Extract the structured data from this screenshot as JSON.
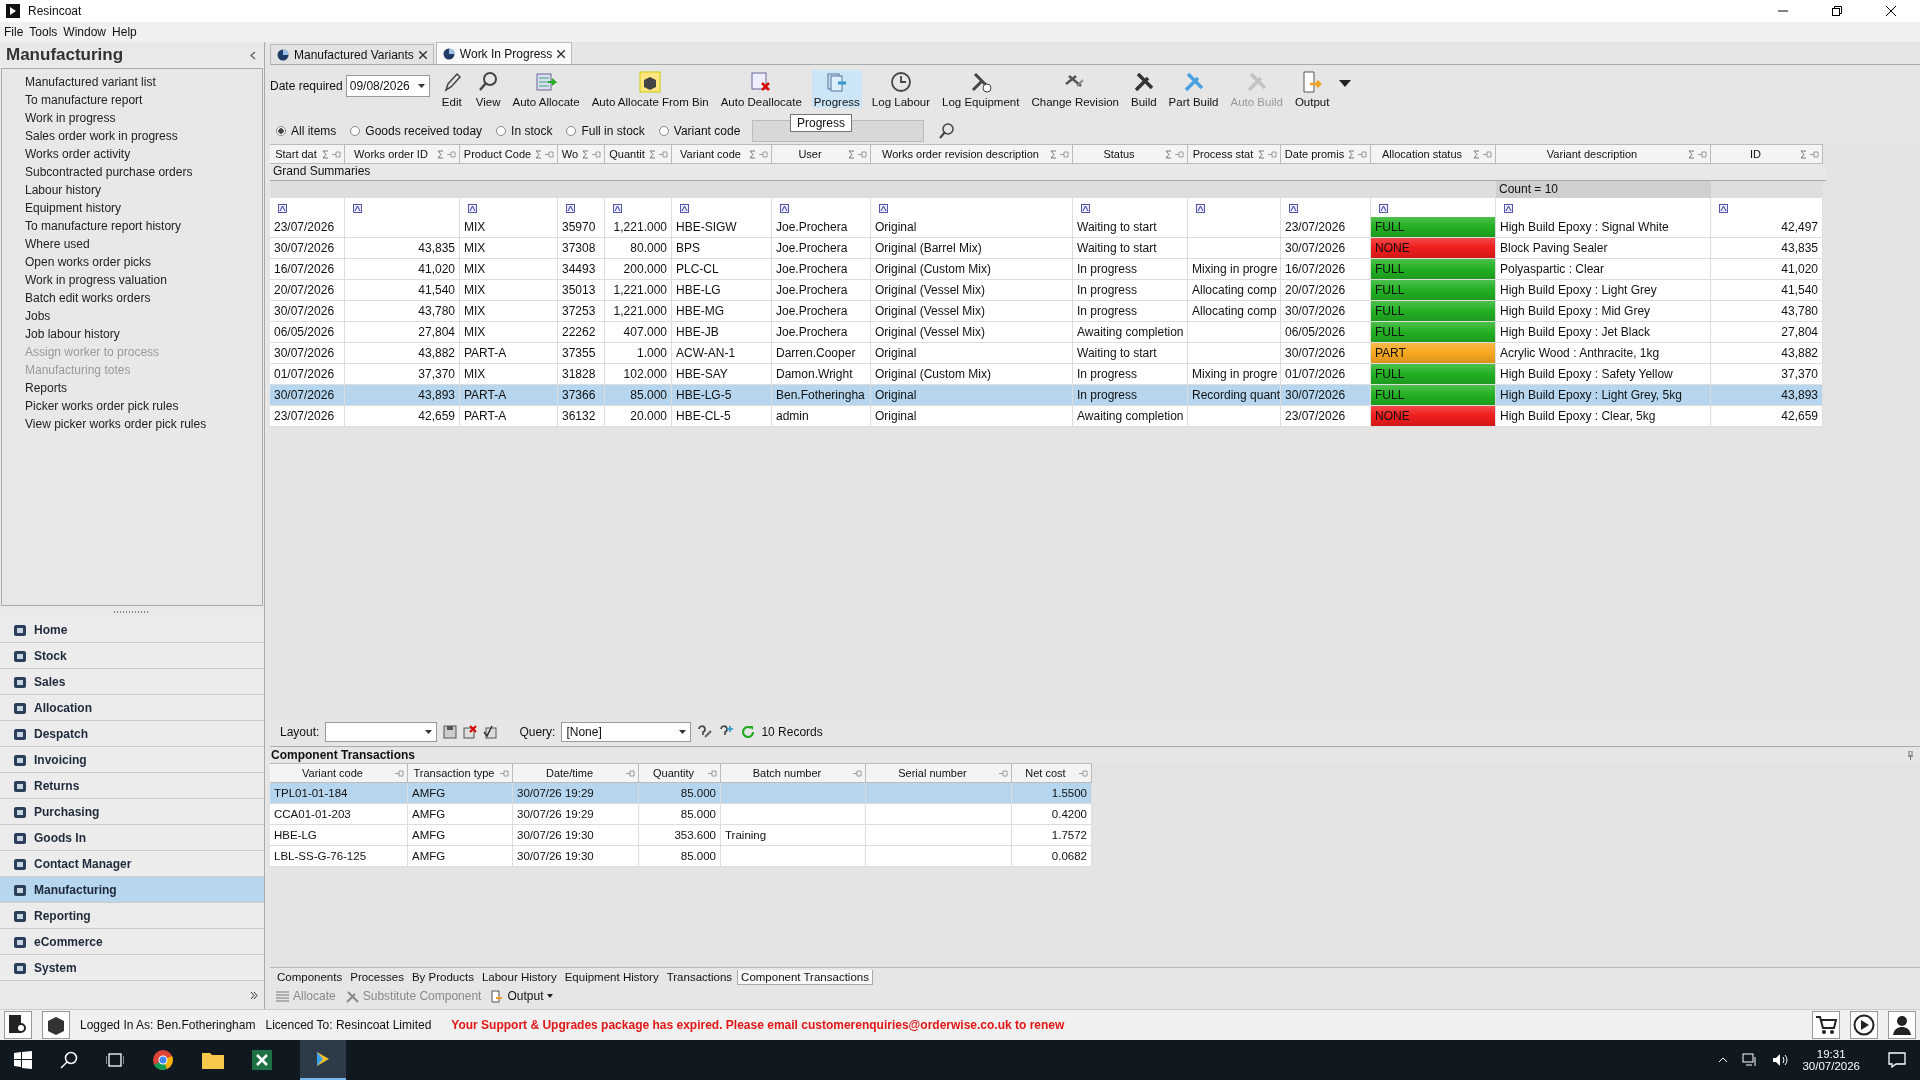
{
  "window": {
    "title": "Resincoat"
  },
  "menu": [
    "File",
    "Tools",
    "Window",
    "Help"
  ],
  "sidebar": {
    "title": "Manufacturing",
    "items": [
      {
        "label": "Manufactured variant list",
        "disabled": false
      },
      {
        "label": "To manufacture report",
        "disabled": false
      },
      {
        "label": "Work in progress",
        "disabled": false
      },
      {
        "label": "Sales order work in progress",
        "disabled": false
      },
      {
        "label": "Works order activity",
        "disabled": false
      },
      {
        "label": "Subcontracted purchase orders",
        "disabled": false
      },
      {
        "label": "Labour history",
        "disabled": false
      },
      {
        "label": "Equipment history",
        "disabled": false
      },
      {
        "label": "To manufacture report history",
        "disabled": false
      },
      {
        "label": "Where used",
        "disabled": false
      },
      {
        "label": "Open works order picks",
        "disabled": false
      },
      {
        "label": "Work in progress valuation",
        "disabled": false
      },
      {
        "label": "Batch edit works orders",
        "disabled": false
      },
      {
        "label": "Jobs",
        "disabled": false
      },
      {
        "label": "Job labour history",
        "disabled": false
      },
      {
        "label": "Assign worker to process",
        "disabled": true
      },
      {
        "label": "Manufacturing totes",
        "disabled": true
      },
      {
        "label": "Reports",
        "disabled": false
      },
      {
        "label": "Picker works order pick rules",
        "disabled": false
      },
      {
        "label": "View picker works order pick rules",
        "disabled": false
      }
    ],
    "modules": [
      {
        "label": "Home",
        "selected": false
      },
      {
        "label": "Stock",
        "selected": false
      },
      {
        "label": "Sales",
        "selected": false
      },
      {
        "label": "Allocation",
        "selected": false
      },
      {
        "label": "Despatch",
        "selected": false
      },
      {
        "label": "Invoicing",
        "selected": false
      },
      {
        "label": "Returns",
        "selected": false
      },
      {
        "label": "Purchasing",
        "selected": false
      },
      {
        "label": "Goods In",
        "selected": false
      },
      {
        "label": "Contact Manager",
        "selected": false
      },
      {
        "label": "Manufacturing",
        "selected": true
      },
      {
        "label": "Reporting",
        "selected": false
      },
      {
        "label": "eCommerce",
        "selected": false
      },
      {
        "label": "System",
        "selected": false
      }
    ]
  },
  "tabs": [
    {
      "label": "Manufactured Variants",
      "selected": false
    },
    {
      "label": "Work In Progress",
      "selected": true
    }
  ],
  "toolbar": {
    "date_label": "Date required",
    "date_value": "09/08/2026",
    "buttons": [
      {
        "label": "Edit",
        "disabled": false,
        "highlighted": false
      },
      {
        "label": "View",
        "disabled": false,
        "highlighted": false
      },
      {
        "label": "Auto Allocate",
        "disabled": false,
        "highlighted": false
      },
      {
        "label": "Auto Allocate From Bin",
        "disabled": false,
        "highlighted": false
      },
      {
        "label": "Auto Deallocate",
        "disabled": false,
        "highlighted": false
      },
      {
        "label": "Progress",
        "disabled": false,
        "highlighted": true
      },
      {
        "label": "Log Labour",
        "disabled": false,
        "highlighted": false
      },
      {
        "label": "Log Equipment",
        "disabled": false,
        "highlighted": false
      },
      {
        "label": "Change Revision",
        "disabled": false,
        "highlighted": false
      },
      {
        "label": "Build",
        "disabled": false,
        "highlighted": false
      },
      {
        "label": "Part Build",
        "disabled": false,
        "highlighted": false
      },
      {
        "label": "Auto Build",
        "disabled": true,
        "highlighted": false
      },
      {
        "label": "Output",
        "disabled": false,
        "highlighted": false
      }
    ],
    "tooltip": "Progress"
  },
  "filters": [
    {
      "label": "All items",
      "selected": true
    },
    {
      "label": "Goods received today",
      "selected": false
    },
    {
      "label": "In stock",
      "selected": false
    },
    {
      "label": "Full in stock",
      "selected": false
    },
    {
      "label": "Variant code",
      "selected": false
    }
  ],
  "table": {
    "columns": [
      "Start dat",
      "Works order ID",
      "Product Code",
      "Wo",
      "Quantit",
      "Variant code",
      "User",
      "Works order revision description",
      "Status",
      "Process stat",
      "Date promis",
      "Allocation status",
      "Variant description",
      "ID"
    ],
    "grand_summaries": "Grand Summaries",
    "count": "Count = 10",
    "rows": [
      {
        "selected": false,
        "cells": [
          "23/07/2026",
          "",
          "MIX",
          "35970",
          "1,221.000",
          "HBE-SIGW",
          "Joe.Prochera",
          "Original",
          "Waiting to start",
          "",
          "23/07/2026",
          "FULL",
          "High Build Epoxy : Signal White",
          "42,497"
        ],
        "color": "#22b022"
      },
      {
        "selected": false,
        "cells": [
          "30/07/2026",
          "43,835",
          "MIX",
          "37308",
          "80.000",
          "BPS",
          "Joe.Prochera",
          "Original (Barrel Mix)",
          "Waiting to start",
          "",
          "30/07/2026",
          "NONE",
          "Block Paving Sealer",
          "43,835"
        ],
        "color": "#f01c1c"
      },
      {
        "selected": false,
        "cells": [
          "16/07/2026",
          "41,020",
          "MIX",
          "34493",
          "200.000",
          "PLC-CL",
          "Joe.Prochera",
          "Original (Custom Mix)",
          "In progress",
          "Mixing in progre",
          "16/07/2026",
          "FULL",
          "Polyaspartic : Clear",
          "41,020"
        ],
        "color": "#22b022"
      },
      {
        "selected": false,
        "cells": [
          "20/07/2026",
          "41,540",
          "MIX",
          "35013",
          "1,221.000",
          "HBE-LG",
          "Joe.Prochera",
          "Original (Vessel Mix)",
          "In progress",
          "Allocating comp",
          "20/07/2026",
          "FULL",
          "High Build Epoxy : Light Grey",
          "41,540"
        ],
        "color": "#22b022"
      },
      {
        "selected": false,
        "cells": [
          "30/07/2026",
          "43,780",
          "MIX",
          "37253",
          "1,221.000",
          "HBE-MG",
          "Joe.Prochera",
          "Original (Vessel Mix)",
          "In progress",
          "Allocating comp",
          "30/07/2026",
          "FULL",
          "High Build Epoxy : Mid Grey",
          "43,780"
        ],
        "color": "#22b022"
      },
      {
        "selected": false,
        "cells": [
          "06/05/2026",
          "27,804",
          "MIX",
          "22262",
          "407.000",
          "HBE-JB",
          "Joe.Prochera",
          "Original (Vessel Mix)",
          "Awaiting completion",
          "",
          "06/05/2026",
          "FULL",
          "High Build Epoxy : Jet Black",
          "27,804"
        ],
        "color": "#22b022"
      },
      {
        "selected": false,
        "cells": [
          "30/07/2026",
          "43,882",
          "PART-A",
          "37355",
          "1.000",
          "ACW-AN-1",
          "Darren.Cooper",
          "Original",
          "Waiting to start",
          "",
          "30/07/2026",
          "PART",
          "Acrylic Wood : Anthracite, 1kg",
          "43,882"
        ],
        "color": "#f8a820"
      },
      {
        "selected": false,
        "cells": [
          "01/07/2026",
          "37,370",
          "MIX",
          "31828",
          "102.000",
          "HBE-SAY",
          "Damon.Wright",
          "Original (Custom Mix)",
          "In progress",
          "Mixing in progre",
          "01/07/2026",
          "FULL",
          "High Build Epoxy : Safety Yellow",
          "37,370"
        ],
        "color": "#22b022"
      },
      {
        "selected": true,
        "cells": [
          "30/07/2026",
          "43,893",
          "PART-A",
          "37366",
          "85.000",
          "HBE-LG-5",
          "Ben.Fotheringha",
          "Original",
          "In progress",
          "Recording quant",
          "30/07/2026",
          "FULL",
          "High Build Epoxy : Light Grey, 5kg",
          "43,893"
        ],
        "color": "#22b022"
      },
      {
        "selected": false,
        "cells": [
          "23/07/2026",
          "42,659",
          "PART-A",
          "36132",
          "20.000",
          "HBE-CL-5",
          "admin",
          "Original",
          "Awaiting completion",
          "",
          "23/07/2026",
          "NONE",
          "High Build Epoxy : Clear, 5kg",
          "42,659"
        ],
        "color": "#f01c1c"
      }
    ]
  },
  "layout_bar": {
    "layout_label": "Layout:",
    "query_label": "Query:",
    "query_value": "[None]",
    "records": "10 Records"
  },
  "component_transactions": {
    "title": "Component Transactions",
    "columns": [
      "Variant code",
      "Transaction type",
      "Date/time",
      "Quantity",
      "Batch number",
      "Serial number",
      "Net cost"
    ],
    "rows": [
      {
        "selected": true,
        "cells": [
          "TPL01-01-184",
          "AMFG",
          "30/07/26 19:29",
          "85.000",
          "",
          "",
          "1.5500"
        ]
      },
      {
        "selected": false,
        "cells": [
          "CCA01-01-203",
          "AMFG",
          "30/07/26 19:29",
          "85.000",
          "",
          "",
          "0.4200"
        ]
      },
      {
        "selected": false,
        "cells": [
          "HBE-LG",
          "AMFG",
          "30/07/26 19:30",
          "353.600",
          "Training",
          "",
          "1.7572"
        ]
      },
      {
        "selected": false,
        "cells": [
          "LBL-SS-G-76-125",
          "AMFG",
          "30/07/26 19:30",
          "85.000",
          "",
          "",
          "0.0682"
        ]
      }
    ]
  },
  "detail_tabs": [
    {
      "label": "Components",
      "selected": false
    },
    {
      "label": "Processes",
      "selected": false
    },
    {
      "label": "By Products",
      "selected": false
    },
    {
      "label": "Labour History",
      "selected": false
    },
    {
      "label": "Equipment History",
      "selected": false
    },
    {
      "label": "Transactions",
      "selected": false
    },
    {
      "label": "Component Transactions",
      "selected": true
    }
  ],
  "detail_actions": [
    {
      "label": "Allocate",
      "disabled": true
    },
    {
      "label": "Substitute Component",
      "disabled": true
    },
    {
      "label": "Output",
      "disabled": false
    }
  ],
  "status_bar": {
    "logged_in": "Logged In As: Ben.Fotheringham",
    "licence": "Licenced To: Resincoat Limited",
    "message": "Your Support & Upgrades package has expired. Please email customerenquiries@orderwise.co.uk to renew"
  },
  "taskbar": {
    "time": "19:31",
    "date": "30/07/2026"
  }
}
